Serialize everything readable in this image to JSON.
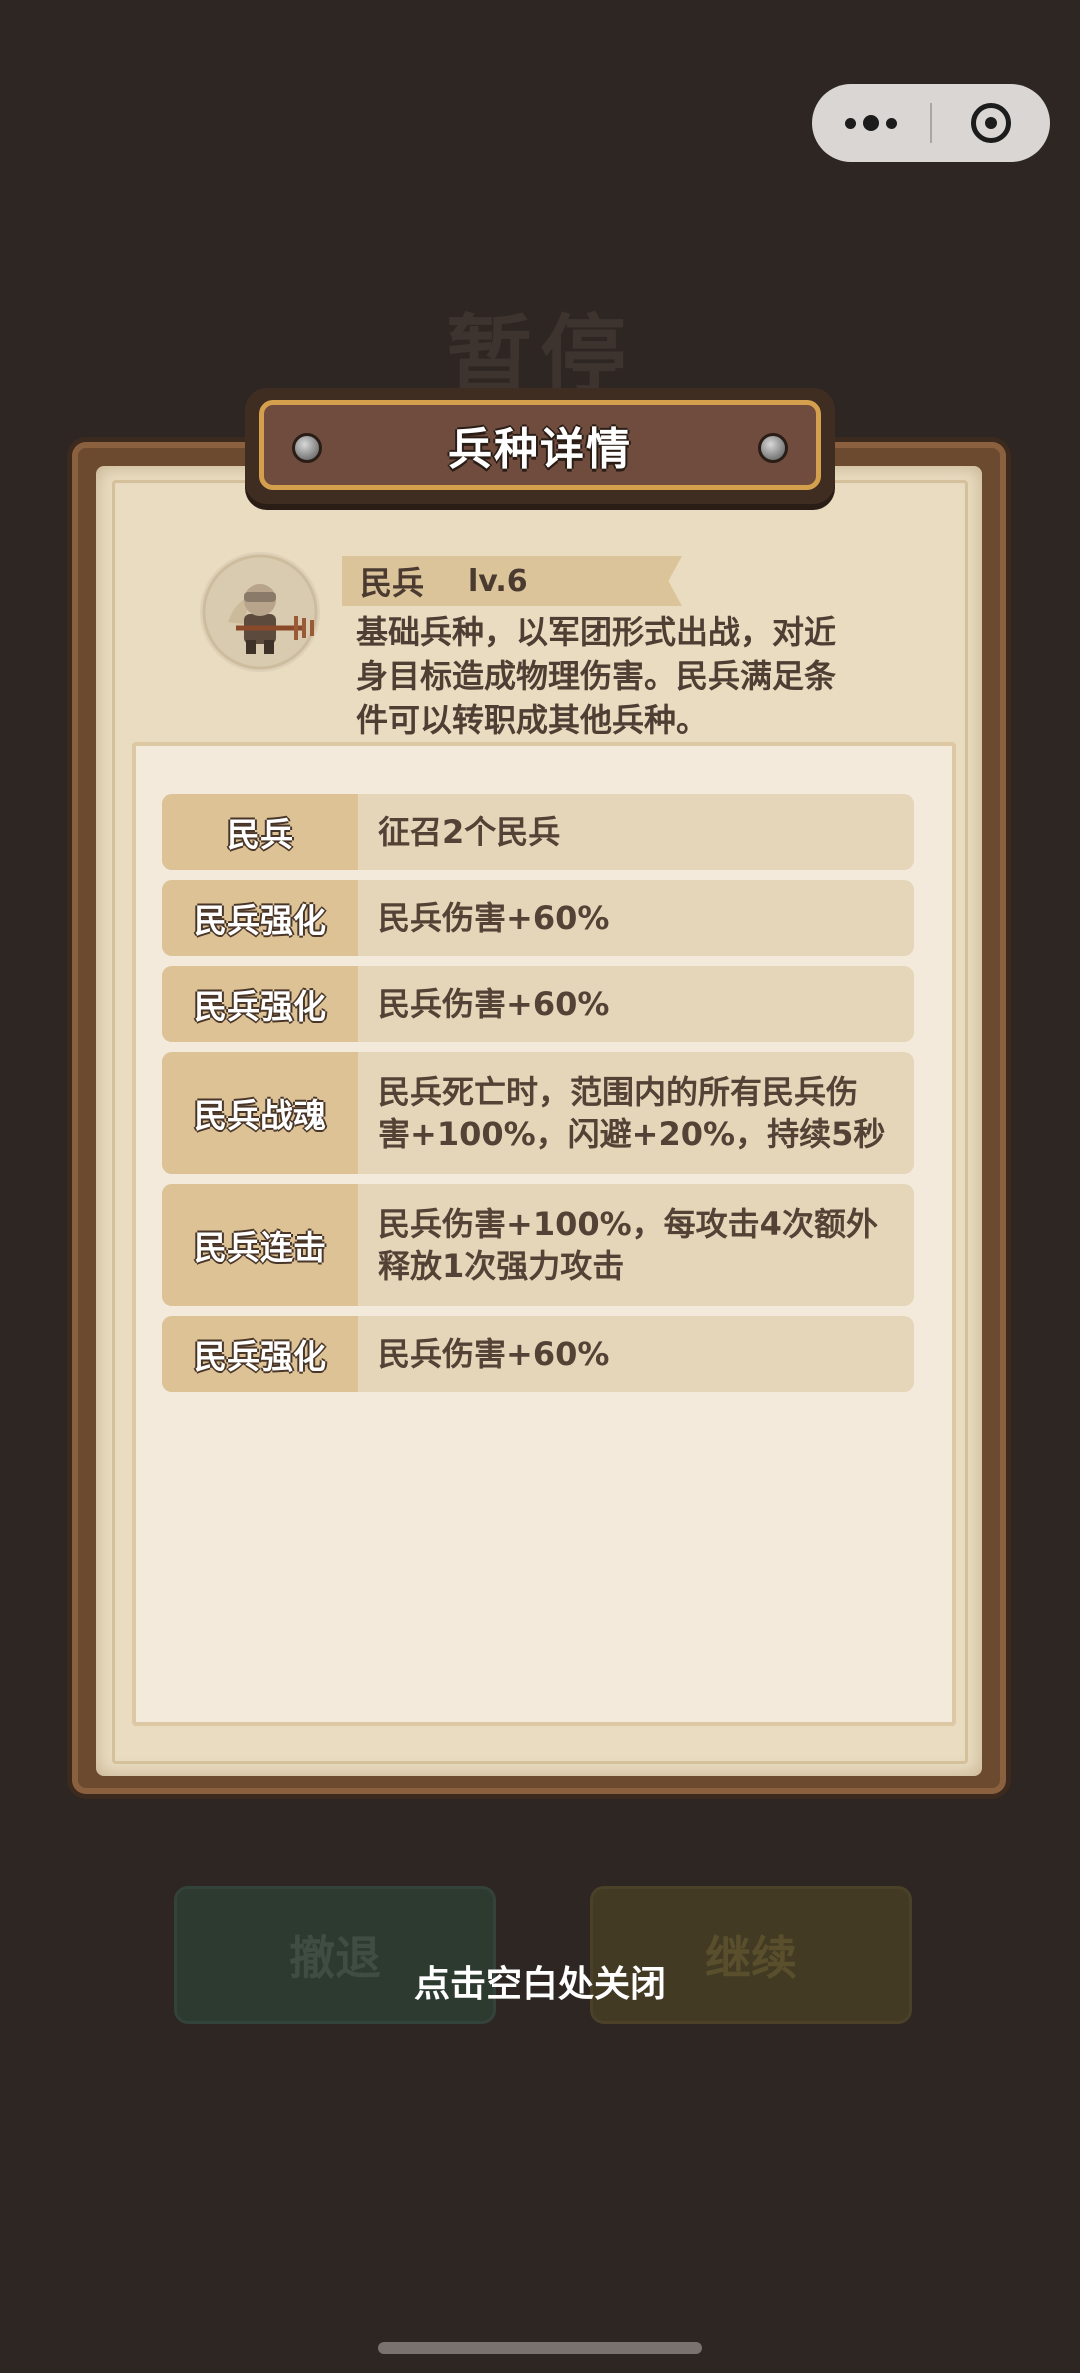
{
  "background": {
    "pause_title": "暂停",
    "retreat_label": "撤退",
    "continue_label": "继续"
  },
  "hint": "点击空白处关闭",
  "capsule": {
    "more_icon": "more-dots-icon",
    "close_icon": "target-close-icon"
  },
  "dialog": {
    "title": "兵种详情",
    "unit": {
      "name": "民兵",
      "level": "lv.6",
      "description_lines": [
        "基础兵种，以军团形式出战，对近",
        "身目标造成物理伤害。民兵满足条",
        "件可以转职成其他兵种。"
      ]
    },
    "rows": [
      {
        "label": "民兵",
        "lines": [
          "征召2个民兵"
        ]
      },
      {
        "label": "民兵强化",
        "lines": [
          "民兵伤害+60%"
        ]
      },
      {
        "label": "民兵强化",
        "lines": [
          "民兵伤害+60%"
        ]
      },
      {
        "label": "民兵战魂",
        "lines": [
          "民兵死亡时，范围内的所有民兵伤",
          "害+100%，闪避+20%，持续5秒"
        ]
      },
      {
        "label": "民兵连击",
        "lines": [
          "民兵伤害+100%，每攻击4次额外",
          "释放1次强力攻击"
        ]
      },
      {
        "label": "民兵强化",
        "lines": [
          "民兵伤害+60%"
        ]
      }
    ]
  }
}
